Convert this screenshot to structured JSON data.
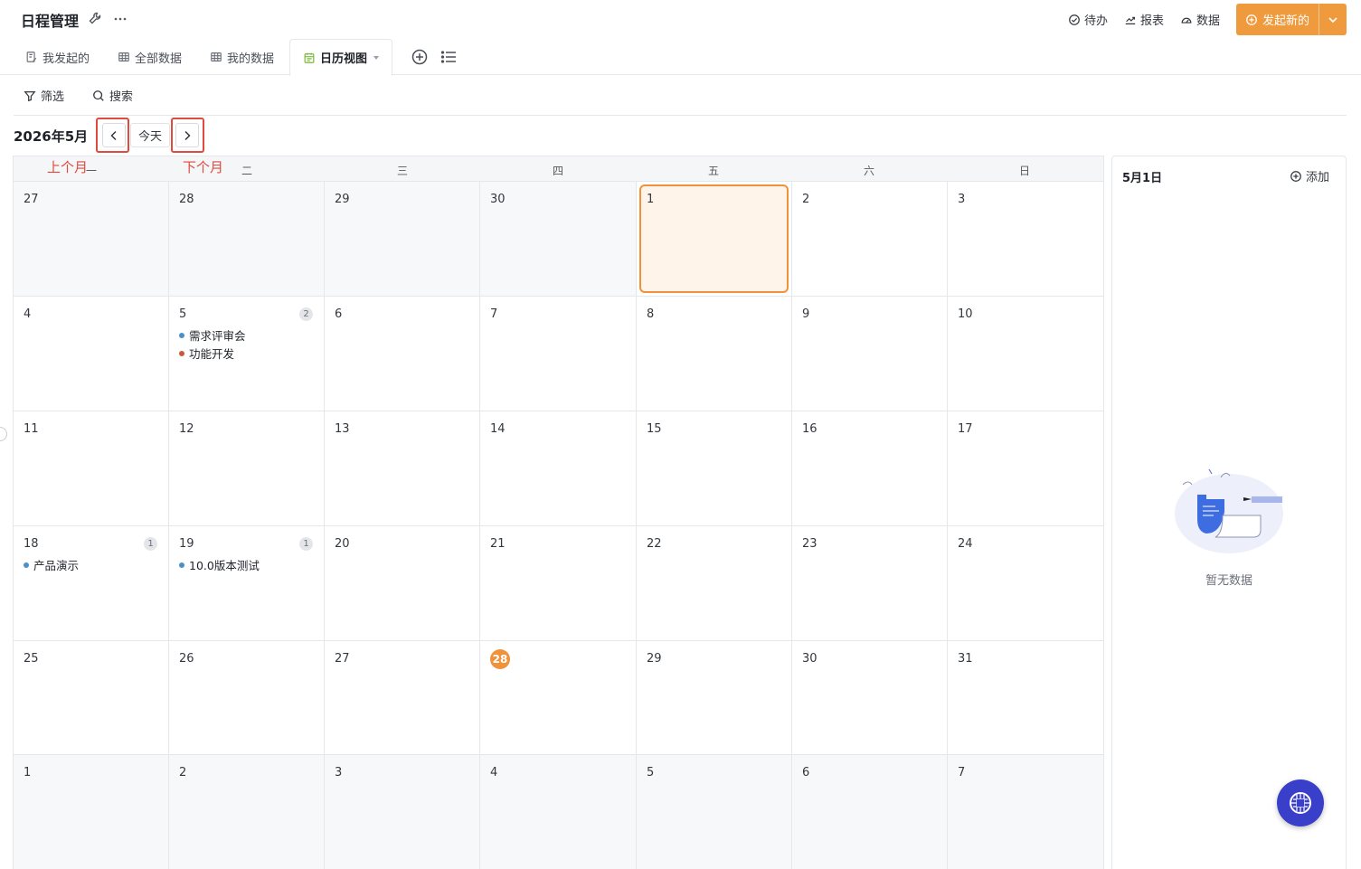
{
  "app": {
    "title": "日程管理"
  },
  "top_actions": {
    "todo": "待办",
    "report": "报表",
    "data": "数据",
    "launch": "发起新的"
  },
  "tabs": [
    {
      "label": "我发起的"
    },
    {
      "label": "全部数据"
    },
    {
      "label": "我的数据"
    },
    {
      "label": "日历视图",
      "active": true
    }
  ],
  "filters": {
    "filter": "筛选",
    "search": "搜索"
  },
  "calendar": {
    "month_label": "2026年5月",
    "today_label": "今天",
    "weekdays": [
      "一",
      "二",
      "三",
      "四",
      "五",
      "六",
      "日"
    ],
    "weeks": [
      [
        "27",
        "28",
        "29",
        "30",
        "1",
        "2",
        "3"
      ],
      [
        "4",
        "5",
        "6",
        "7",
        "8",
        "9",
        "10"
      ],
      [
        "11",
        "12",
        "13",
        "14",
        "15",
        "16",
        "17"
      ],
      [
        "18",
        "19",
        "20",
        "21",
        "22",
        "23",
        "24"
      ],
      [
        "25",
        "26",
        "27",
        "28",
        "29",
        "30",
        "31"
      ],
      [
        "1",
        "2",
        "3",
        "4",
        "5",
        "6",
        "7"
      ]
    ],
    "events": {
      "may5": {
        "count": "2",
        "items": [
          "需求评审会",
          "功能开发"
        ]
      },
      "may18": {
        "count": "1",
        "items": [
          "产品演示"
        ]
      },
      "may19": {
        "count": "1",
        "items": [
          "10.0版本测试"
        ]
      }
    },
    "colors": {
      "accent": "#f0923a",
      "event_blue": "#4a90c9",
      "event_red": "#c85a3c",
      "annotation": "#e04a3f"
    }
  },
  "annotations": {
    "prev": "上个月",
    "next": "下个月"
  },
  "side_panel": {
    "date": "5月1日",
    "add": "添加",
    "empty": "暂无数据"
  }
}
